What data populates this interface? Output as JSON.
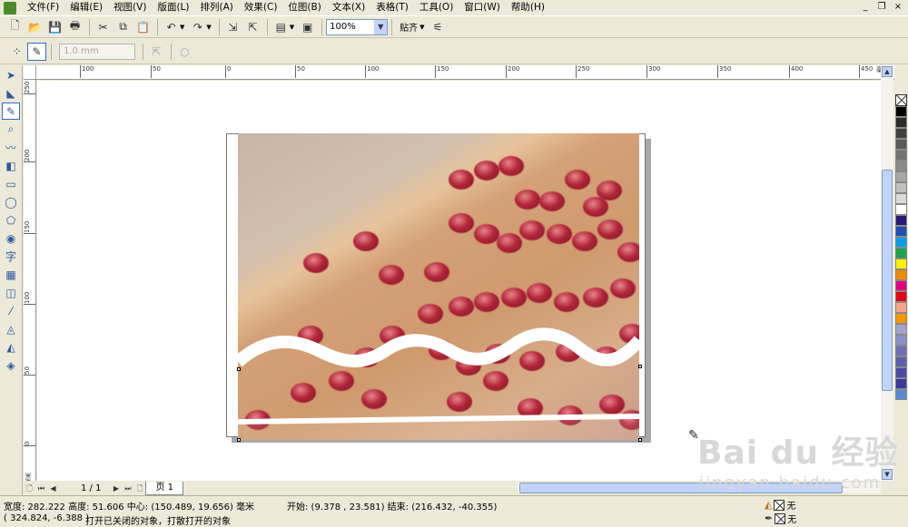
{
  "menu": {
    "items": [
      "文件(F)",
      "编辑(E)",
      "视图(V)",
      "版面(L)",
      "排列(A)",
      "效果(C)",
      "位图(B)",
      "文本(X)",
      "表格(T)",
      "工具(O)",
      "窗口(W)",
      "帮助(H)"
    ]
  },
  "window_controls": {
    "minimize": "_",
    "restore": "❐",
    "close": "×"
  },
  "toolbar": {
    "zoom_value": "100%",
    "snap_label": "贴齐"
  },
  "property_bar": {
    "outline_width": "1.0 mm"
  },
  "rulers": {
    "h_ticks": [
      "100",
      "50",
      "0",
      "50",
      "100",
      "150",
      "200",
      "250",
      "300",
      "350",
      "400",
      "450"
    ],
    "h_unit": "毫米",
    "v_ticks": [
      "250",
      "200",
      "150",
      "100",
      "50",
      "0",
      "-50"
    ],
    "v_unit": "毫米"
  },
  "pagebar": {
    "page_count": "1 / 1",
    "page_tab": "页 1"
  },
  "status": {
    "dimensions": "宽度: 282.222  高度: 51.606  中心: (150.489, 19.656)  毫米",
    "range": "开始: (9.378 , 23.581)  结束: (216.432, -40.355)",
    "coords": "( 324.824, -6.388 )",
    "hint": "打开已关闭的对象，打散打开的对象",
    "fill_label": "无",
    "outline_label": "无"
  },
  "palette": {
    "colors": [
      "#000000",
      "#2b2b2b",
      "#404040",
      "#595959",
      "#737373",
      "#8c8c8c",
      "#a6a6a6",
      "#bfbfbf",
      "#d9d9d9",
      "#ffffff",
      "#2a1a7a",
      "#1f4fb5",
      "#00a0e9",
      "#1aa34a",
      "#fff100",
      "#f08c00",
      "#e4007f",
      "#e60012",
      "#f6a38c",
      "#f39800",
      "#a2a2d0",
      "#8890c8",
      "#6f6fb8",
      "#5d5db0",
      "#4a4aa6",
      "#3a3a9c",
      "#5a8ad0"
    ]
  },
  "watermark": {
    "main": "Bai du 经验",
    "sub": "jingyan.baidu.com"
  },
  "icons": {
    "new": "new-icon",
    "open": "open-icon",
    "save": "save-icon",
    "print": "print-icon",
    "cut": "cut-icon",
    "copy": "copy-icon",
    "paste": "paste-icon",
    "undo": "undo-icon",
    "redo": "redo-icon"
  }
}
